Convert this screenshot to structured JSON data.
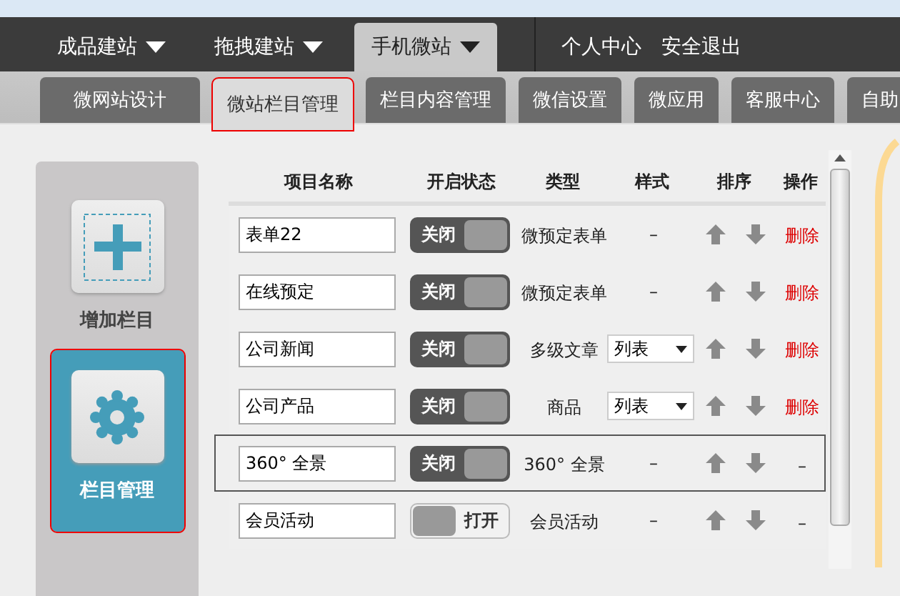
{
  "top_nav": {
    "items": [
      {
        "label": "成品建站",
        "selected": false
      },
      {
        "label": "拖拽建站",
        "selected": false
      },
      {
        "label": "手机微站",
        "selected": true
      }
    ],
    "links": [
      "个人中心",
      "安全退出"
    ]
  },
  "sub_tabs": [
    {
      "label": "微网站设计",
      "selected": false
    },
    {
      "label": "微站栏目管理",
      "selected": true
    },
    {
      "label": "栏目内容管理",
      "selected": false
    },
    {
      "label": "微信设置",
      "selected": false
    },
    {
      "label": "微应用",
      "selected": false
    },
    {
      "label": "客服中心",
      "selected": false
    },
    {
      "label": "自助",
      "selected": false
    }
  ],
  "sidebar": {
    "items": [
      {
        "kind": "add",
        "label": "增加栏目",
        "selected": false
      },
      {
        "kind": "manage",
        "label": "栏目管理",
        "selected": true
      }
    ]
  },
  "table": {
    "columns": [
      "项目名称",
      "开启状态",
      "类型",
      "样式",
      "排序",
      "操作"
    ],
    "rows": [
      {
        "name": "表单22",
        "on": false,
        "toggle_label": "关闭",
        "type": "微预定表单",
        "style": {
          "kind": "dash",
          "text": "–"
        },
        "action": {
          "kind": "delete",
          "text": "删除"
        },
        "highlighted": false
      },
      {
        "name": "在线预定",
        "on": false,
        "toggle_label": "关闭",
        "type": "微预定表单",
        "style": {
          "kind": "dash",
          "text": "–"
        },
        "action": {
          "kind": "delete",
          "text": "删除"
        },
        "highlighted": false
      },
      {
        "name": "公司新闻",
        "on": false,
        "toggle_label": "关闭",
        "type": "多级文章",
        "style": {
          "kind": "select",
          "text": "列表"
        },
        "action": {
          "kind": "delete",
          "text": "删除"
        },
        "highlighted": false
      },
      {
        "name": "公司产品",
        "on": false,
        "toggle_label": "关闭",
        "type": "商品",
        "style": {
          "kind": "select",
          "text": "列表"
        },
        "action": {
          "kind": "delete",
          "text": "删除"
        },
        "highlighted": false
      },
      {
        "name": "360° 全景",
        "on": false,
        "toggle_label": "关闭",
        "type": "360° 全景",
        "style": {
          "kind": "dash",
          "text": "–"
        },
        "action": {
          "kind": "dash",
          "text": "–"
        },
        "highlighted": true
      },
      {
        "name": "会员活动",
        "on": true,
        "toggle_label": "打开",
        "type": "会员活动",
        "style": {
          "kind": "dash",
          "text": "–"
        },
        "action": {
          "kind": "dash",
          "text": "–"
        },
        "highlighted": false
      }
    ]
  }
}
